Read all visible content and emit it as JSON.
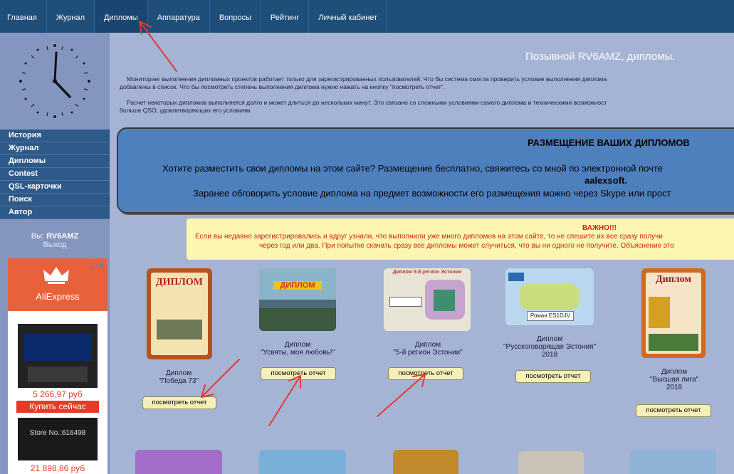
{
  "nav": {
    "items": [
      {
        "label": "Главная"
      },
      {
        "label": "Журнал"
      },
      {
        "label": "Дипломы"
      },
      {
        "label": "Аппаратура"
      },
      {
        "label": "Вопросы"
      },
      {
        "label": "Рейтинг"
      },
      {
        "label": "Личный кабинет"
      }
    ]
  },
  "sidebar": {
    "items": [
      {
        "label": "История"
      },
      {
        "label": "Журнал"
      },
      {
        "label": "Дипломы"
      },
      {
        "label": "Contest"
      },
      {
        "label": "QSL-карточки"
      },
      {
        "label": "Поиск"
      },
      {
        "label": "Автор"
      }
    ],
    "user_prefix": "Вы:",
    "user_callsign": "RV6AMZ",
    "logout": "Выход"
  },
  "ad": {
    "brand": "AliExpress",
    "price1": "5 266,97 руб",
    "buy": "Купить сейчас",
    "store": "Store No.:616498",
    "price2": "21 898,86 руб"
  },
  "main": {
    "title": "Позывной RV6AMZ, дипломы.",
    "para1_l1": "Мониторинг выполнения дипломных проектов работает только для зарегистрированных пользователей. Что бы система смогла проверить условие выполнения диплома",
    "para1_l2": "добавлены в список. Что бы посмотреть степень выполнения диплома нужно нажать на кнопку \"посмотреть отчет\".",
    "para2_l1": "Расчет некоторых дипломов выполняется долго и может длиться до нескольких минут. Это связано со сложными условиями самого диплома и техническими возможност",
    "para2_l2": "больше QSO, удовлетворяющих его условиям.",
    "placement_heading": "РАЗМЕЩЕНИЕ ВАШИХ ДИПЛОМОВ",
    "placement_l1": "Хотите разместить свои дипломы на этом сайте? Размещение бесплатно, свяжитесь со мной по электронной почте",
    "placement_email": "aalexsoft.",
    "placement_l3": "Заранее обговорить условие диплома на предмет возможности его размещения можно через Skype или прост",
    "important_heading": "ВАЖНО!!!",
    "important_l1": "Если вы недавно зарегистрировались и вдруг узнали, что выполнили уже много дипломов на этом сайте, то не спешите их все сразу получи",
    "important_l2": "через год или два. При попытке скачать сразу все дипломы может случиться, что вы ни одного не получите. Объяснение это"
  },
  "diplomas": [
    {
      "caption": "Диплом\n\"Победа 73\"",
      "button": "посмотреть отчет",
      "img_text": "ДИПЛОМ"
    },
    {
      "caption": "Диплом\n\"Усвяты, моя любовь!\"",
      "button": "посмотреть отчет",
      "img_text": "ДИПЛОМ"
    },
    {
      "caption": "Диплом\n\"5-й регион Эстонии\"",
      "button": "посмотреть отчет",
      "img_text": "Диплом 5-й регион Эстонии"
    },
    {
      "caption": "Диплом\n\"Русскоговорящая Эстония\"\n2018",
      "button": "посмотреть отчет",
      "img_text": "Роман ES1DJV"
    },
    {
      "caption": "Диплом\n\"Высшая лига\"\n2018",
      "button": "посмотреть отчет",
      "img_text": "Диплом"
    }
  ],
  "colors": {
    "nav_bg": "#1f4e79",
    "page_bg": "#a5b3d4",
    "arrow": "#e53935"
  }
}
